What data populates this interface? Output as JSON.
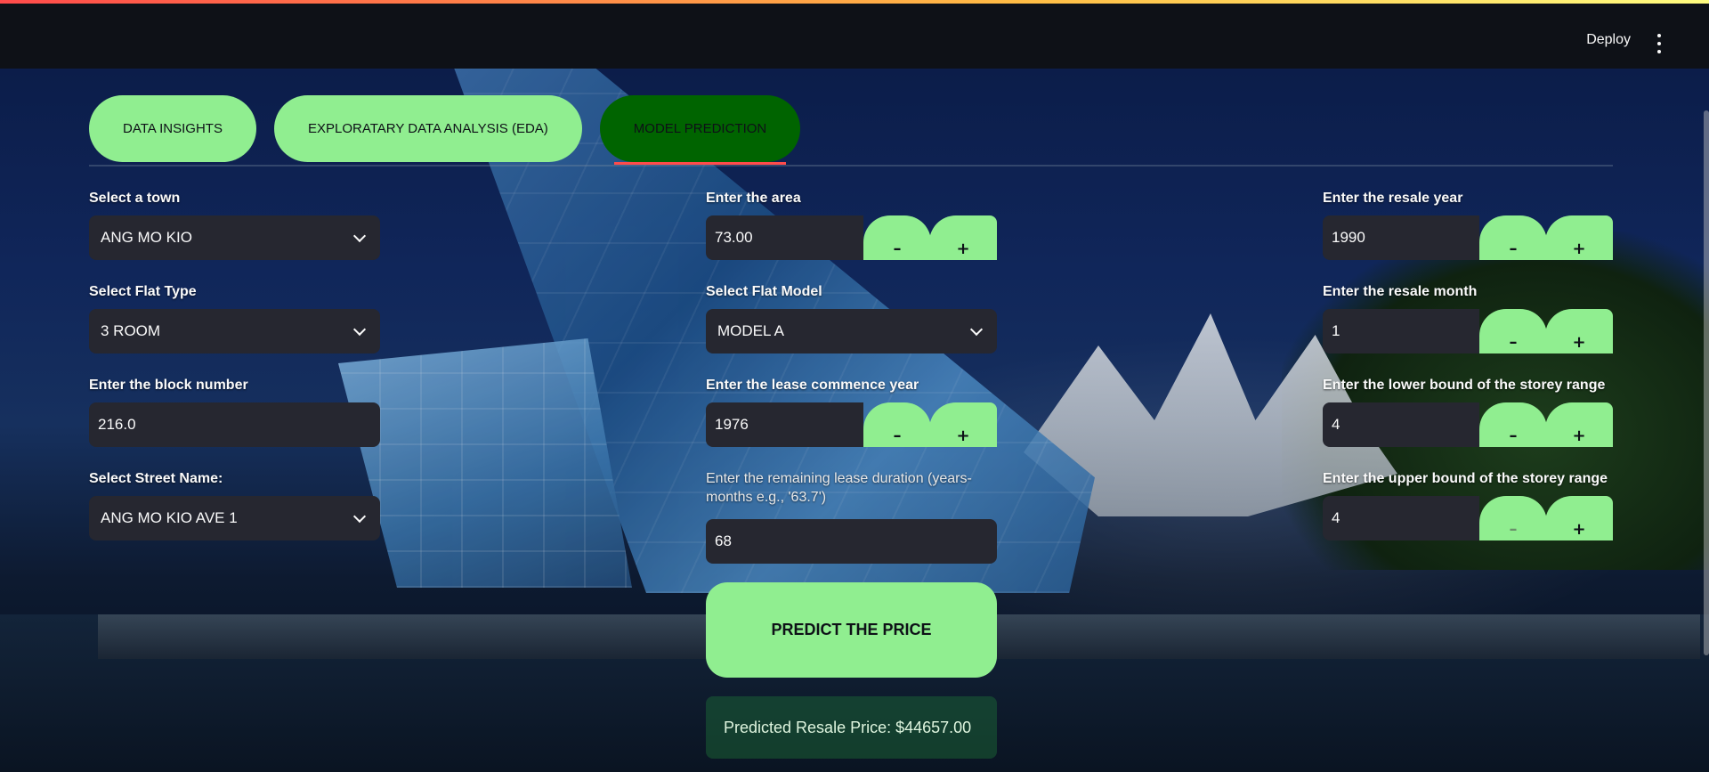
{
  "header": {
    "deploy_label": "Deploy",
    "menu_icon": "kebab-menu-icon"
  },
  "tabs": [
    {
      "label": "DATA INSIGHTS",
      "active": false
    },
    {
      "label": "EXPLORATARY DATA ANALYSIS (EDA)",
      "active": false
    },
    {
      "label": "MODEL PREDICTION",
      "active": true
    }
  ],
  "form": {
    "town": {
      "label": "Select a town",
      "value": "ANG MO KIO"
    },
    "flat_type": {
      "label": "Select Flat Type",
      "value": "3 ROOM"
    },
    "block": {
      "label": "Enter the block number",
      "value": "216.0"
    },
    "street": {
      "label": "Select Street Name:",
      "value": "ANG MO KIO AVE 1"
    },
    "area": {
      "label": "Enter the area",
      "value": "73.00"
    },
    "flat_model": {
      "label": "Select Flat Model",
      "value": "MODEL A"
    },
    "lease_commence": {
      "label": "Enter the lease commence year",
      "value": "1976"
    },
    "remaining_lease": {
      "label": "Enter the remaining lease duration (years-months e.g., '63.7')",
      "value": "68"
    },
    "resale_year": {
      "label": "Enter the resale year",
      "value": "1990"
    },
    "resale_month": {
      "label": "Enter the resale month",
      "value": "1"
    },
    "storey_lower": {
      "label": "Enter the lower bound of the storey range",
      "value": "4"
    },
    "storey_upper": {
      "label": "Enter the upper bound of the storey range",
      "value": "4"
    },
    "minus_symbol": "–",
    "plus_symbol": "+"
  },
  "predict_button_label": "PREDICT THE PRICE",
  "result_text": "Predicted Resale Price: $44657.00",
  "colors": {
    "accent_green": "#90ee90",
    "active_tab": "#006400",
    "input_bg": "#262730",
    "header_bg": "#0e1117",
    "tab_underline": "#ff4b4b"
  }
}
